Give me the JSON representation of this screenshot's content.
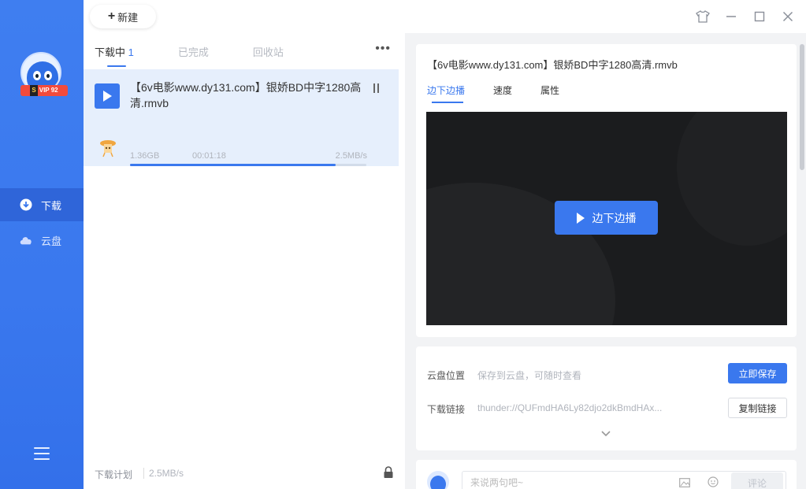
{
  "sidebar": {
    "vip_badge": "SVIP 92级 ★",
    "vip_badge_short": "VIP 92",
    "items": [
      {
        "label": "下载",
        "icon": "download-icon"
      },
      {
        "label": "云盘",
        "icon": "cloud-icon"
      }
    ]
  },
  "topbar": {
    "new_button": "新建"
  },
  "list": {
    "tabs": [
      {
        "label": "下载中",
        "count": "1"
      },
      {
        "label": "已完成"
      },
      {
        "label": "回收站"
      }
    ],
    "more": "•••",
    "task": {
      "name": "【6v电影www.dy131.com】银娇BD中字1280高清.rmvb",
      "size": "1.36GB",
      "elapsed": "00:01:18",
      "speed": "2.5MB/s",
      "progress": 0.87
    },
    "plan_label": "下载计划",
    "plan_speed": "2.5MB/s"
  },
  "detail": {
    "title": "【6v电影www.dy131.com】银娇BD中字1280高清.rmvb",
    "tabs": [
      "边下边播",
      "速度",
      "属性"
    ],
    "play_button": "边下边播",
    "cloud_label": "云盘位置",
    "cloud_value": "保存到云盘，可随时查看",
    "save_button": "立即保存",
    "link_label": "下载链接",
    "link_value": "thunder://QUFmdHA6Ly82djo2dkBmdHAx...",
    "copy_button": "复制链接"
  },
  "comment": {
    "placeholder": "来说两句吧~",
    "send_button": "评论"
  },
  "colors": {
    "accent": "#3a78ee",
    "sidebar": "#3f7ef0",
    "task_bg": "#e6effc",
    "video_bg": "#1b1c1e"
  }
}
